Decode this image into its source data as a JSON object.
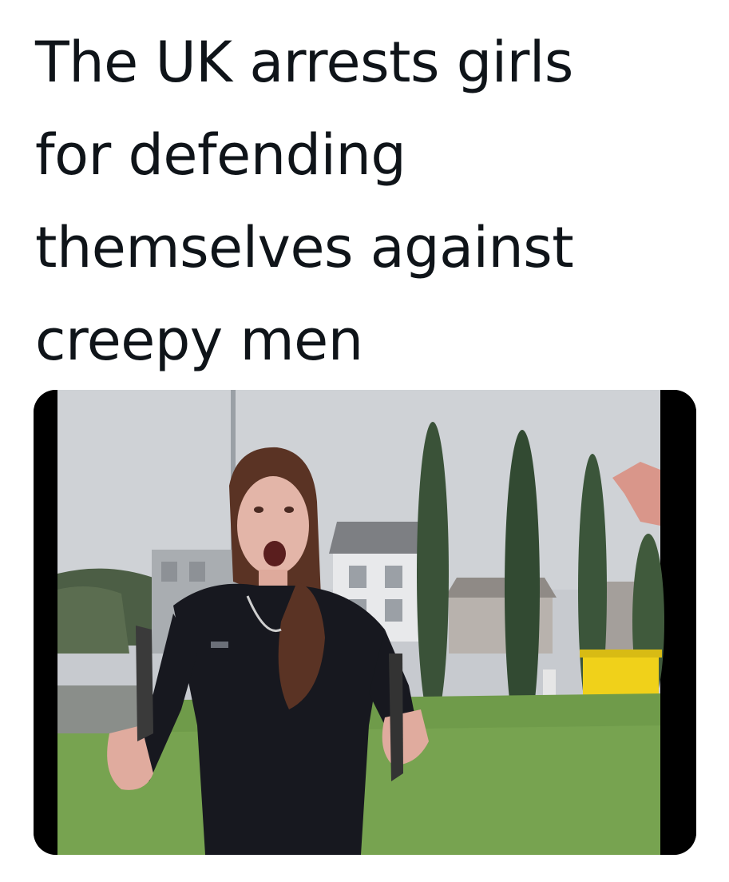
{
  "post": {
    "text": "The UK arrests girls\nfor defending\nthemselves against\ncreepy men"
  },
  "media": {
    "type": "video-still",
    "letterbox_color": "#000000",
    "sky_color": "#c9ccd0",
    "grass_color": "#6e9a4a",
    "tree_color": "#2f4a33",
    "bin_color": "#f2d21a"
  }
}
